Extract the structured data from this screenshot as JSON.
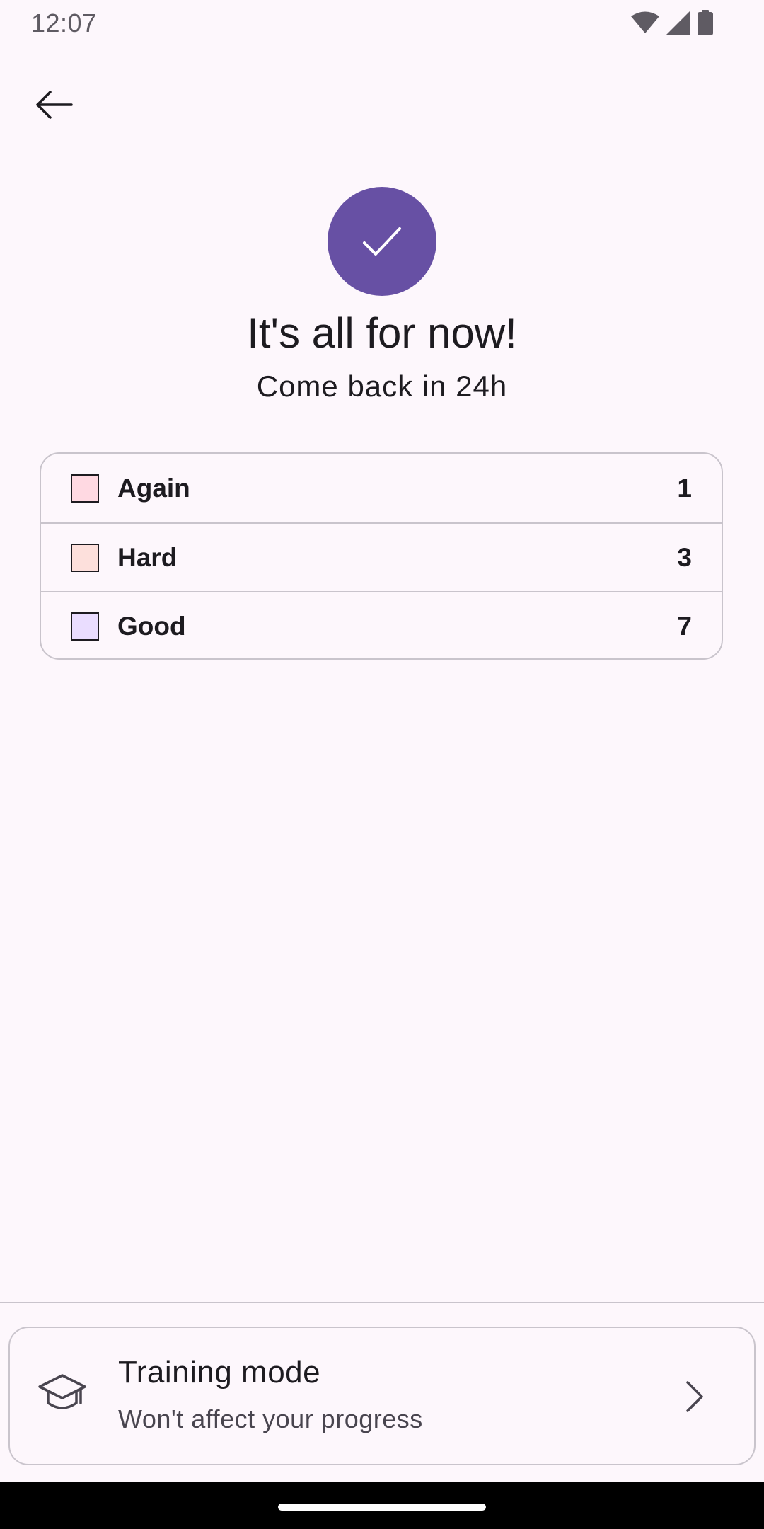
{
  "status_bar": {
    "time": "12:07",
    "icons": [
      "wifi-icon",
      "cellular-signal-icon",
      "battery-icon"
    ]
  },
  "toolbar": {
    "back_icon": "arrow-back-icon"
  },
  "completion": {
    "icon": "check-icon",
    "accent_color": "#6750a4",
    "title": "It's all for now!",
    "subtitle": "Come back in 24h"
  },
  "results": [
    {
      "label": "Again",
      "count": "1",
      "color": "#ffd9e2"
    },
    {
      "label": "Hard",
      "count": "3",
      "color": "#fde0dc"
    },
    {
      "label": "Good",
      "count": "7",
      "color": "#eaddff"
    }
  ],
  "training": {
    "icon": "graduation-cap-icon",
    "title": "Training mode",
    "subtitle": "Won't affect your progress",
    "chevron_icon": "chevron-right-icon"
  }
}
